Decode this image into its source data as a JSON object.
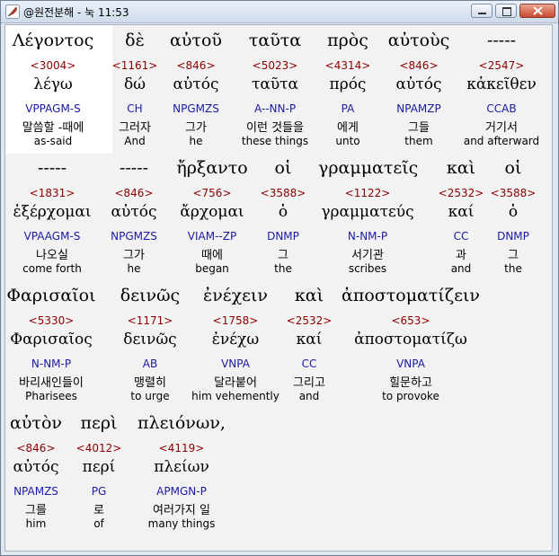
{
  "window": {
    "title": "@원전분해 - 눅 11:53",
    "icons": {
      "app": "feather-icon",
      "minimize": "minimize-icon",
      "maximize": "maximize-icon",
      "close": "close-icon"
    }
  },
  "rows": [
    [
      {
        "greek": "Λέγοντος",
        "strong": "<3004>",
        "lemma": "λέγω",
        "parse": "VPPAGM-S",
        "korean": "말씀할 -때에",
        "english": "as-said"
      },
      {
        "greek": "δὲ",
        "strong": "<1161>",
        "lemma": "δώ",
        "parse": "CH",
        "korean": "그러자",
        "english": "And"
      },
      {
        "greek": "αὐτοῦ",
        "strong": "<846>",
        "lemma": "αὐτός",
        "parse": "NPGMZS",
        "korean": "그가",
        "english": "he"
      },
      {
        "greek": "ταῦτα",
        "strong": "<5023>",
        "lemma": "ταῦτα",
        "parse": "A--NN-P",
        "korean": "이런 것들을",
        "english": "these things"
      },
      {
        "greek": "πρὸς",
        "strong": "<4314>",
        "lemma": "πρός",
        "parse": "PA",
        "korean": "에게",
        "english": "unto"
      },
      {
        "greek": "αὐτοὺς",
        "strong": "<846>",
        "lemma": "αὐτός",
        "parse": "NPAMZP",
        "korean": "그들",
        "english": "them"
      },
      {
        "greek": "-----",
        "strong": "<2547>",
        "lemma": "κἀκεῖθεν",
        "parse": "CCAB",
        "korean": "거기서",
        "english": "and afterward"
      }
    ],
    [
      {
        "greek": "-----",
        "strong": "<1831>",
        "lemma": "ἐξέρχομαι",
        "parse": "VPAAGM-S",
        "korean": "나오실",
        "english": "come forth"
      },
      {
        "greek": "-----",
        "strong": "<846>",
        "lemma": "αὐτός",
        "parse": "NPGMZS",
        "korean": "그가",
        "english": "he"
      },
      {
        "greek": "ἤρξαντο",
        "strong": "<756>",
        "lemma": "ἄρχομαι",
        "parse": "VIAM--ZP",
        "korean": "때에",
        "english": "began"
      },
      {
        "greek": "οἱ",
        "strong": "<3588>",
        "lemma": "ὁ",
        "parse": "DNMP",
        "korean": "그",
        "english": "the"
      },
      {
        "greek": "γραμματεῖς",
        "strong": "<1122>",
        "lemma": "γραμματεύς",
        "parse": "N-NM-P",
        "korean": "서기관",
        "english": "scribes"
      },
      {
        "greek": "καὶ",
        "strong": "<2532>",
        "lemma": "καί",
        "parse": "CC",
        "korean": "과",
        "english": "and"
      },
      {
        "greek": "οἱ",
        "strong": "<3588>",
        "lemma": "ὁ",
        "parse": "DNMP",
        "korean": "그",
        "english": "the"
      }
    ],
    [
      {
        "greek": "Φαρισαῖοι",
        "strong": "<5330>",
        "lemma": "Φαρισαῖος",
        "parse": "N-NM-P",
        "korean": "바리새인들이",
        "english": "Pharisees"
      },
      {
        "greek": "δεινῶς",
        "strong": "<1171>",
        "lemma": "δεινῶς",
        "parse": "AB",
        "korean": "맹렬히",
        "english": "to urge"
      },
      {
        "greek": "ἐνέχειν",
        "strong": "<1758>",
        "lemma": "ἐνέχω",
        "parse": "VNPA",
        "korean": "달라붙어",
        "english": "him vehemently"
      },
      {
        "greek": "καὶ",
        "strong": "<2532>",
        "lemma": "καί",
        "parse": "CC",
        "korean": "그리고",
        "english": "and"
      },
      {
        "greek": "ἀποστοματίζειν",
        "strong": "<653>",
        "lemma": "ἀποστοματίζω",
        "parse": "VNPA",
        "korean": "힐문하고",
        "english": "to provoke"
      }
    ],
    [
      {
        "greek": "αὐτὸν",
        "strong": "<846>",
        "lemma": "αὐτός",
        "parse": "NPAMZS",
        "korean": "그를",
        "english": "him"
      },
      {
        "greek": "περὶ",
        "strong": "<4012>",
        "lemma": "περί",
        "parse": "PG",
        "korean": "로",
        "english": "of"
      },
      {
        "greek": "πλειόνων,",
        "strong": "<4119>",
        "lemma": "πλείων",
        "parse": "APMGN-P",
        "korean": "여러가지 일",
        "english": "many things"
      }
    ]
  ]
}
